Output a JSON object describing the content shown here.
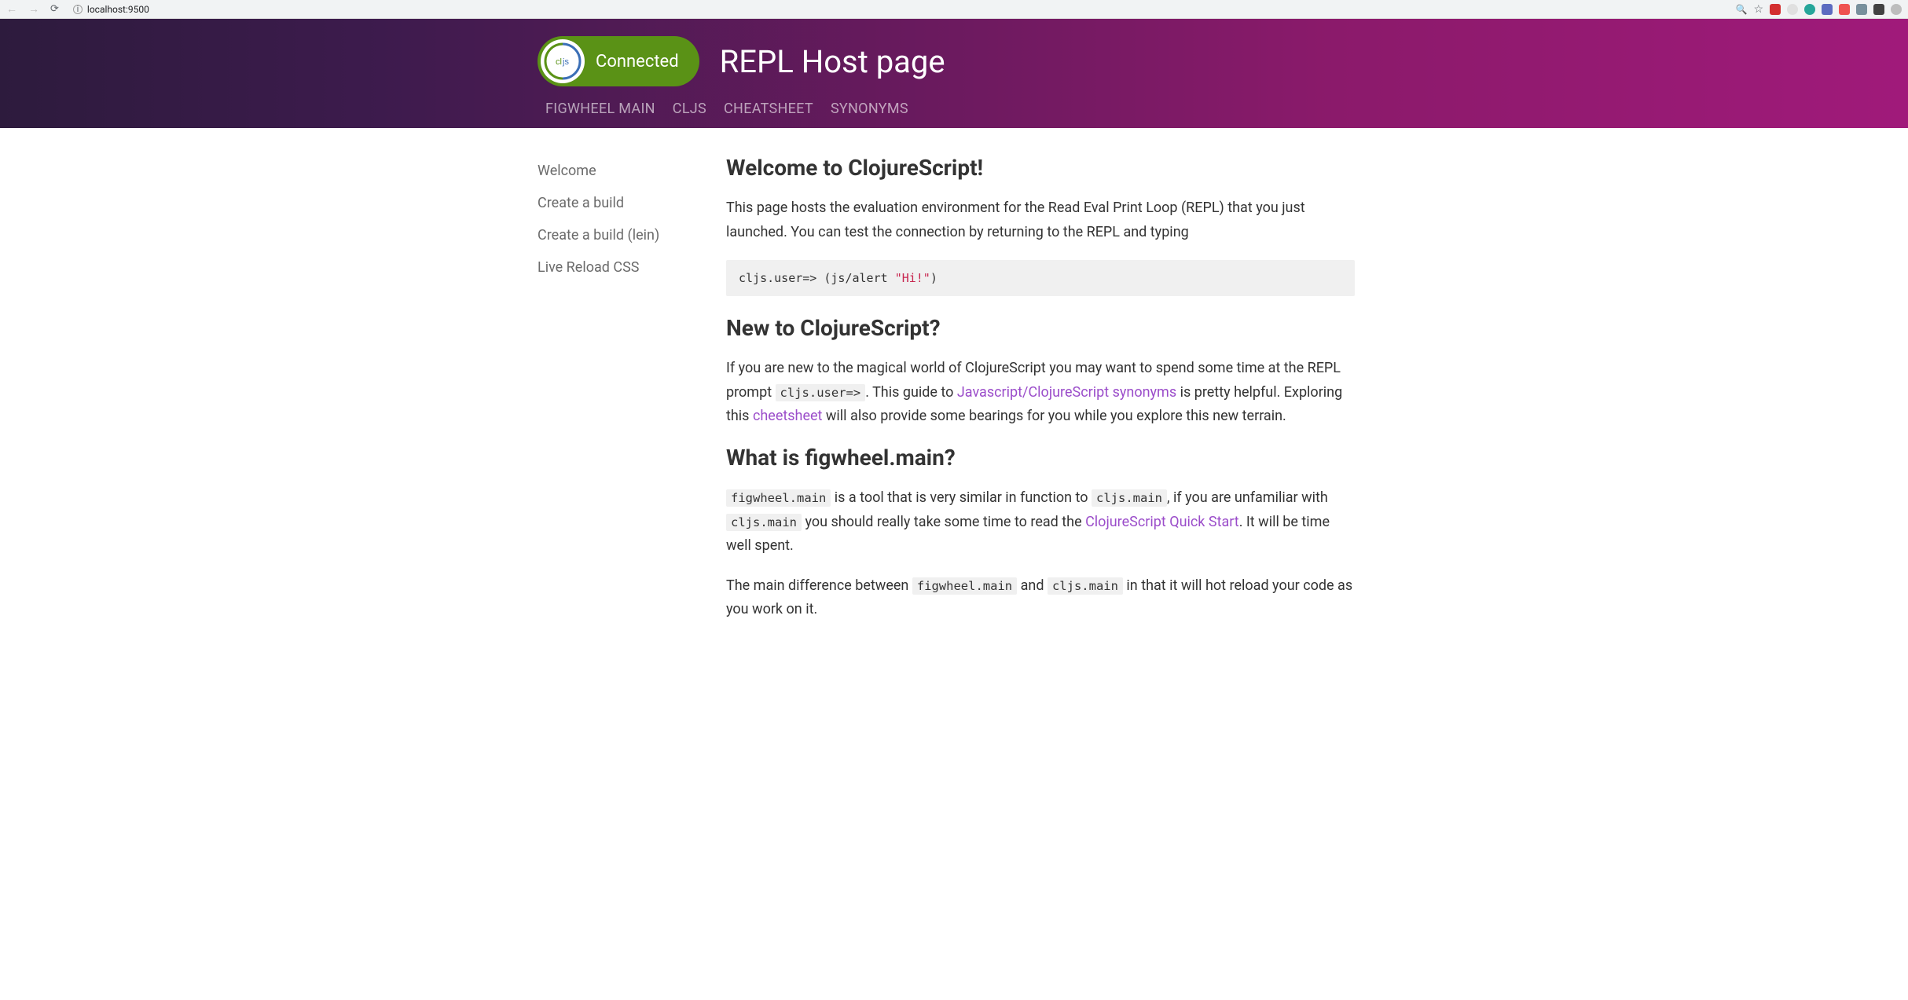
{
  "browser": {
    "url": "localhost:9500"
  },
  "header": {
    "connected_label": "Connected",
    "page_title": "REPL Host page",
    "nav": [
      "FIGWHEEL MAIN",
      "CLJS",
      "CHEATSHEET",
      "SYNONYMS"
    ]
  },
  "sidebar": {
    "items": [
      "Welcome",
      "Create a build",
      "Create a build (lein)",
      "Live Reload CSS"
    ]
  },
  "content": {
    "h1": "Welcome to ClojureScript!",
    "p1": "This page hosts the evaluation environment for the Read Eval Print Loop (REPL) that you just launched. You can test the connection by returning to the REPL and typing",
    "code1_pre": "cljs.user=> (js/alert ",
    "code1_str": "\"Hi!\"",
    "code1_post": ")",
    "h2": "New to ClojureScript?",
    "p2a": "If you are new to the magical world of ClojureScript you may want to spend some time at the REPL prompt ",
    "p2_code": "cljs.user=>",
    "p2b": ". This guide to ",
    "p2_link1": "Javascript/ClojureScript synonyms",
    "p2c": " is pretty helpful. Exploring this ",
    "p2_link2": "cheetsheet",
    "p2d": " will also provide some bearings for you while you explore this new terrain.",
    "h3": "What is figwheel.main?",
    "p3_code1": "figwheel.main",
    "p3a": " is a tool that is very similar in function to ",
    "p3_code2": "cljs.main",
    "p3b": ", if you are unfamiliar with ",
    "p3_code3": "cljs.main",
    "p3c": " you should really take some time to read the ",
    "p3_link1": "ClojureScript Quick Start",
    "p3d": ". It will be time well spent.",
    "p4a": "The main difference between ",
    "p4_code1": "figwheel.main",
    "p4b": " and ",
    "p4_code2": "cljs.main",
    "p4c": " in that it will hot reload your code as you work on it."
  }
}
